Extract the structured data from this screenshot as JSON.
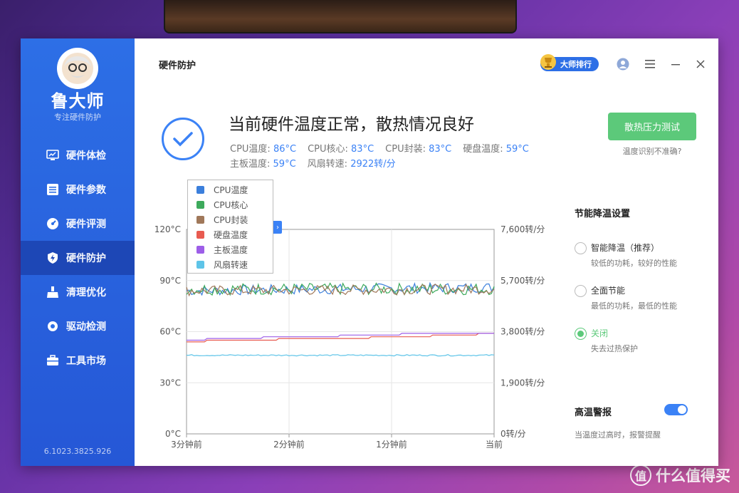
{
  "watermark": {
    "text": "什么值得买",
    "icon": "zhi-logo-icon"
  },
  "sidebar": {
    "app_name": "鲁大师",
    "tagline": "专注硬件防护",
    "version": "6.1023.3825.926",
    "items": [
      {
        "label": "硬件体检",
        "icon": "monitor-icon"
      },
      {
        "label": "硬件参数",
        "icon": "list-icon"
      },
      {
        "label": "硬件评测",
        "icon": "gauge-icon"
      },
      {
        "label": "硬件防护",
        "icon": "shield-bolt-icon",
        "active": true
      },
      {
        "label": "清理优化",
        "icon": "broom-icon"
      },
      {
        "label": "驱动检测",
        "icon": "gear-icon"
      },
      {
        "label": "工具市场",
        "icon": "toolbox-icon"
      }
    ]
  },
  "header": {
    "title": "硬件防护",
    "rank_button": "大师排行",
    "icons": [
      "trophy-icon",
      "user-icon",
      "menu-icon",
      "minimize-icon",
      "close-icon"
    ]
  },
  "status": {
    "headline": "当前硬件温度正常，散热情况良好",
    "row1": [
      {
        "label": "CPU温度:",
        "value": "86°C"
      },
      {
        "label": "CPU核心:",
        "value": "83°C"
      },
      {
        "label": "CPU封装:",
        "value": "83°C"
      },
      {
        "label": "硬盘温度:",
        "value": "59°C"
      }
    ],
    "row2": [
      {
        "label": "主板温度:",
        "value": "59°C"
      },
      {
        "label": "风扇转速:",
        "value": "2922转/分"
      }
    ],
    "stress_button": "散热压力测试",
    "temp_link": "温度识别不准确?"
  },
  "settings": {
    "title": "节能降温设置",
    "options": [
      {
        "label": "智能降温（推荐）",
        "desc": "较低的功耗，较好的性能",
        "checked": false
      },
      {
        "label": "全面节能",
        "desc": "最低的功耗，最低的性能",
        "checked": false
      },
      {
        "label": "关闭",
        "desc": "失去过热保护",
        "checked": true
      }
    ],
    "alarm_title": "高温警报",
    "alarm_desc": "当温度过高时，报警提醒",
    "alarm_on": true
  },
  "chart_data": {
    "type": "line",
    "x_ticks": [
      "3分钟前",
      "2分钟前",
      "1分钟前",
      "当前"
    ],
    "y_left_ticks": [
      "120°C",
      "90°C",
      "60°C",
      "30°C",
      "0°C"
    ],
    "y_right_ticks": [
      "7,600转/分",
      "5,700转/分",
      "3,800转/分",
      "1,900转/分",
      "0转/分"
    ],
    "ylim_left": [
      0,
      120
    ],
    "ylim_right": [
      0,
      7600
    ],
    "grid": true,
    "legend_position": "top-left",
    "series": [
      {
        "name": "CPU温度",
        "color": "#3b7fdc",
        "axis": "left",
        "start": 84,
        "end": 86,
        "noise": 3.0
      },
      {
        "name": "CPU核心",
        "color": "#3daa5c",
        "axis": "left",
        "start": 85,
        "end": 85,
        "noise": 3.5
      },
      {
        "name": "CPU封装",
        "color": "#a0785a",
        "axis": "left",
        "start": 84,
        "end": 85,
        "noise": 3.0
      },
      {
        "name": "硬盘温度",
        "color": "#e85b50",
        "axis": "left",
        "steps": [
          [
            0,
            54
          ],
          [
            0.06,
            55
          ],
          [
            0.3,
            56
          ],
          [
            0.6,
            57
          ],
          [
            0.8,
            58
          ],
          [
            0.95,
            59
          ]
        ]
      },
      {
        "name": "主板温度",
        "color": "#9d5ee8",
        "axis": "left",
        "steps": [
          [
            0,
            55
          ],
          [
            0.06,
            56
          ],
          [
            0.25,
            57
          ],
          [
            0.5,
            58
          ],
          [
            0.7,
            59
          ]
        ]
      },
      {
        "name": "风扇转速",
        "color": "#5ec4e8",
        "axis": "right",
        "start": 2922,
        "end": 2922,
        "noise": 25
      }
    ]
  }
}
